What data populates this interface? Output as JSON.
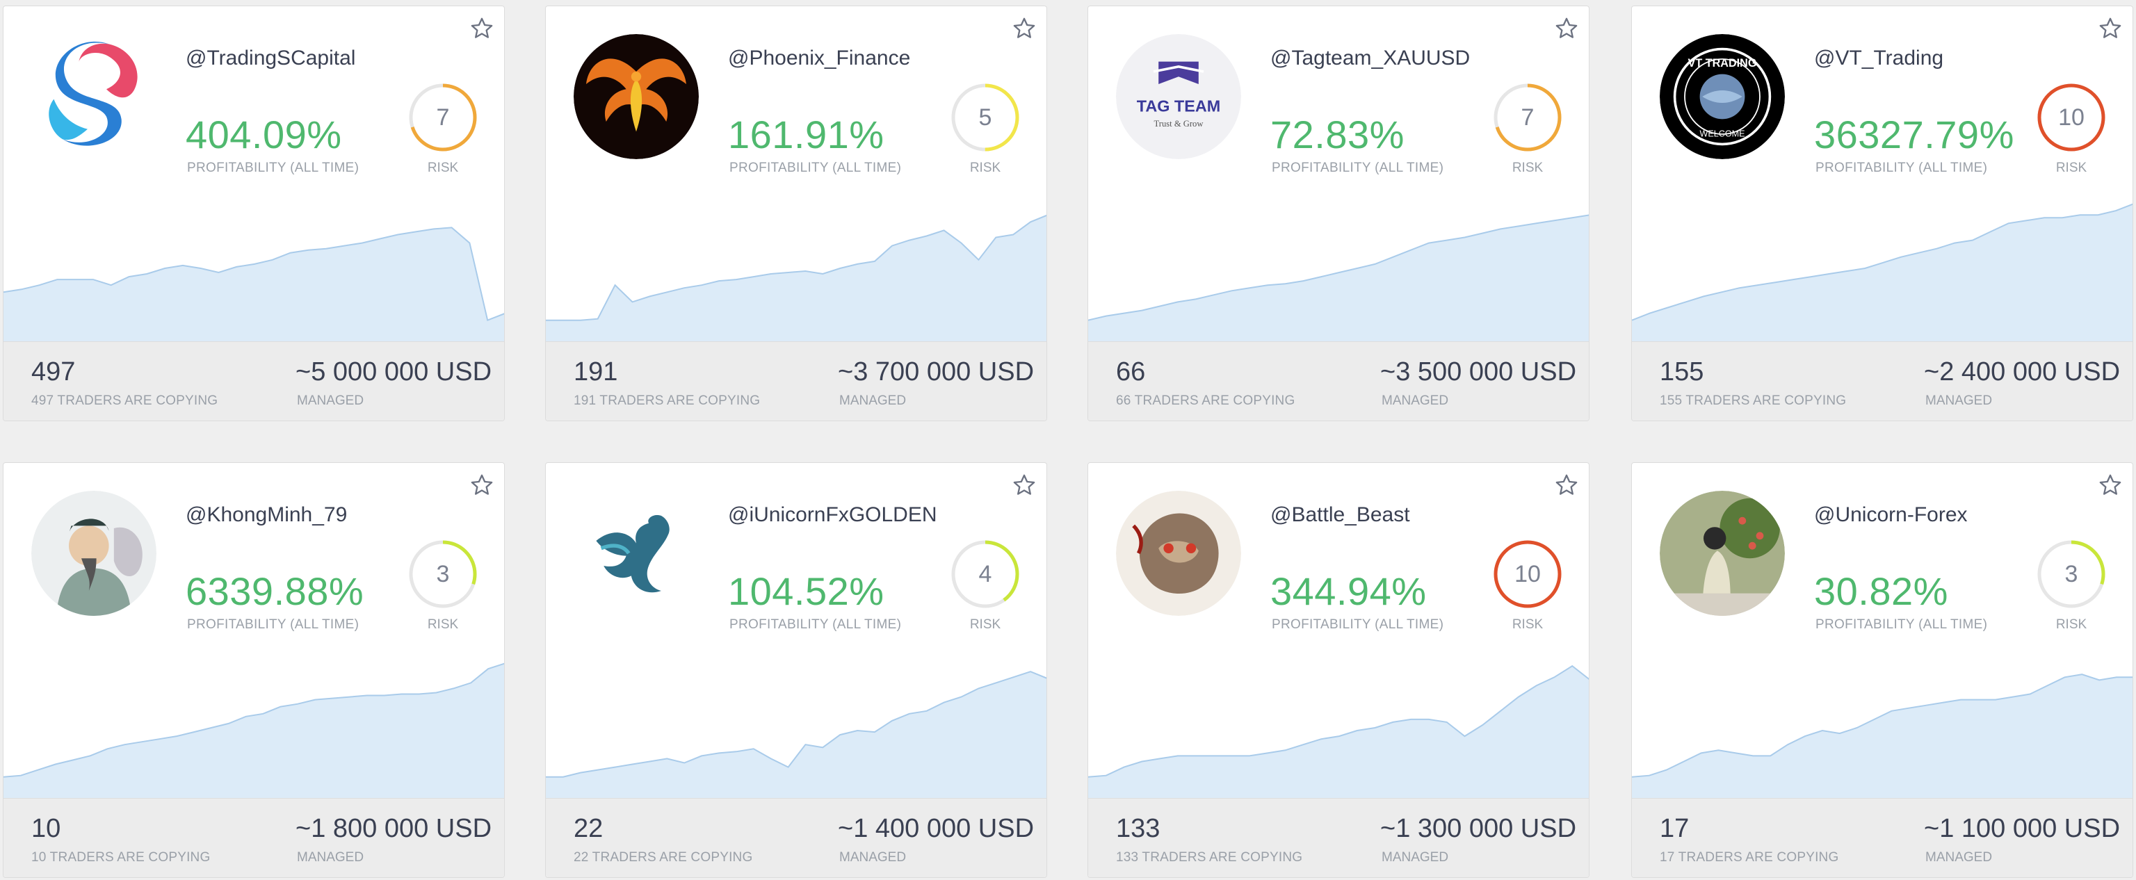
{
  "colors": {
    "profit_green": "#4fb86e",
    "chart_fill": "#dcebf8",
    "chart_line": "#a9cbea",
    "risk_orange": "#f0a83a",
    "risk_yellow": "#f2e64a",
    "risk_red": "#e0502a",
    "risk_lime": "#c9e63a"
  },
  "profit_label": "PROFITABILITY (ALL TIME)",
  "risk_label": "RISK",
  "managed_label": "MANAGED",
  "cards": [
    {
      "handle": "@TradingSCapital",
      "avatar": "s-logo",
      "profit": "404.09%",
      "risk": 7,
      "risk_color": "#f0a83a",
      "copiers": "497",
      "copiers_label": "497 TRADERS ARE COPYING",
      "managed": "~5 000 000 USD",
      "equity": [
        35,
        37,
        40,
        44,
        44,
        44,
        40,
        46,
        48,
        52,
        54,
        52,
        49,
        53,
        55,
        58,
        63,
        65,
        66,
        68,
        70,
        73,
        76,
        78,
        80,
        81,
        70,
        15,
        20
      ]
    },
    {
      "handle": "@Phoenix_Finance",
      "avatar": "phoenix",
      "profit": "161.91%",
      "risk": 5,
      "risk_color": "#f2e64a",
      "copiers": "191",
      "copiers_label": "191 TRADERS ARE COPYING",
      "managed": "~3 700 000 USD",
      "equity": [
        15,
        15,
        15,
        16,
        40,
        28,
        32,
        35,
        38,
        40,
        43,
        44,
        46,
        48,
        49,
        50,
        48,
        52,
        55,
        57,
        68,
        72,
        75,
        79,
        70,
        58,
        74,
        76,
        85,
        90
      ]
    },
    {
      "handle": "@Tagteam_XAUUSD",
      "avatar": "tagteam",
      "profit": "72.83%",
      "risk": 7,
      "risk_color": "#f0a83a",
      "copiers": "66",
      "copiers_label": "66 TRADERS ARE COPYING",
      "managed": "~3 500 000 USD",
      "equity": [
        15,
        18,
        20,
        22,
        25,
        28,
        30,
        33,
        36,
        38,
        40,
        41,
        43,
        46,
        49,
        52,
        55,
        60,
        65,
        70,
        72,
        74,
        77,
        80,
        82,
        84,
        86,
        88,
        90
      ]
    },
    {
      "handle": "@VT_Trading",
      "avatar": "vt",
      "profit": "36327.79%",
      "risk": 10,
      "risk_color": "#e0502a",
      "copiers": "155",
      "copiers_label": "155 TRADERS ARE COPYING",
      "managed": "~2 400 000 USD",
      "equity": [
        15,
        20,
        24,
        28,
        32,
        35,
        38,
        40,
        42,
        44,
        46,
        48,
        50,
        52,
        56,
        60,
        63,
        66,
        70,
        72,
        78,
        84,
        86,
        88,
        88,
        90,
        90,
        93,
        98
      ]
    },
    {
      "handle": "@KhongMinh_79",
      "avatar": "khongminh",
      "profit": "6339.88%",
      "risk": 3,
      "risk_color": "#c9e63a",
      "copiers": "10",
      "copiers_label": "10 TRADERS ARE COPYING",
      "managed": "~1 800 000 USD",
      "equity": [
        15,
        16,
        20,
        24,
        27,
        30,
        35,
        38,
        40,
        42,
        44,
        47,
        50,
        53,
        58,
        60,
        65,
        67,
        70,
        71,
        72,
        73,
        73,
        74,
        74,
        75,
        78,
        82,
        92,
        96
      ]
    },
    {
      "handle": "@iUnicornFxGOLDEN",
      "avatar": "pegasus",
      "profit": "104.52%",
      "risk": 4,
      "risk_color": "#c9e63a",
      "copiers": "22",
      "copiers_label": "22 TRADERS ARE COPYING",
      "managed": "~1 400 000 USD",
      "equity": [
        15,
        15,
        18,
        20,
        22,
        24,
        26,
        28,
        25,
        30,
        32,
        33,
        35,
        28,
        22,
        38,
        36,
        45,
        48,
        47,
        55,
        60,
        62,
        68,
        72,
        78,
        82,
        86,
        90,
        85
      ]
    },
    {
      "handle": "@Battle_Beast",
      "avatar": "beast",
      "profit": "344.94%",
      "risk": 10,
      "risk_color": "#e0502a",
      "copiers": "133",
      "copiers_label": "133 TRADERS ARE COPYING",
      "managed": "~1 300 000 USD",
      "equity": [
        15,
        16,
        22,
        26,
        28,
        30,
        30,
        30,
        30,
        30,
        32,
        34,
        38,
        42,
        44,
        48,
        50,
        54,
        56,
        56,
        54,
        44,
        52,
        62,
        72,
        80,
        86,
        94,
        84
      ]
    },
    {
      "handle": "@Unicorn-Forex",
      "avatar": "person",
      "profit": "30.82%",
      "risk": 3,
      "risk_color": "#c9e63a",
      "copiers": "17",
      "copiers_label": "17 TRADERS ARE COPYING",
      "managed": "~1 100 000 USD",
      "equity": [
        15,
        16,
        20,
        26,
        32,
        34,
        32,
        30,
        30,
        38,
        44,
        48,
        46,
        50,
        56,
        62,
        64,
        66,
        68,
        70,
        70,
        70,
        72,
        74,
        80,
        86,
        88,
        84,
        86,
        86
      ]
    }
  ]
}
